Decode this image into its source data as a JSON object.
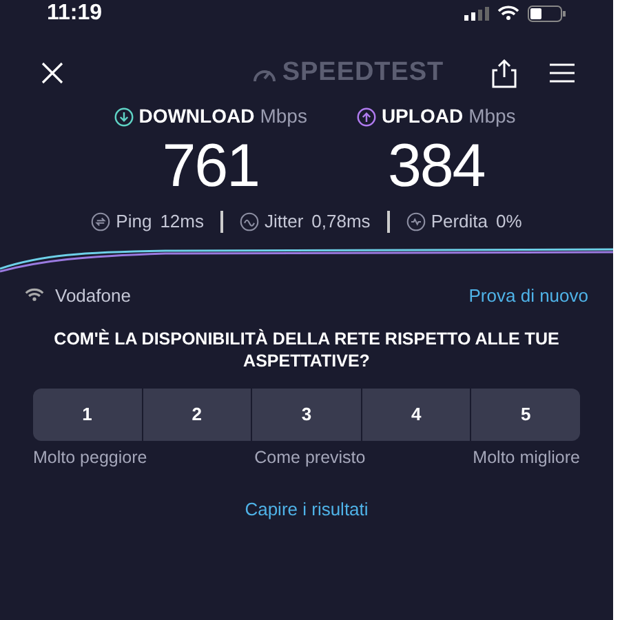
{
  "status_bar": {
    "time": "11:19"
  },
  "header": {
    "title": "SPEEDTEST"
  },
  "results": [
    {
      "kind": "download",
      "label": "DOWNLOAD",
      "unit": "Mbps",
      "value": "761"
    },
    {
      "kind": "upload",
      "label": "UPLOAD",
      "unit": "Mbps",
      "value": "384"
    }
  ],
  "stats": [
    {
      "kind": "ping",
      "label": "Ping",
      "value": "12ms"
    },
    {
      "kind": "jitter",
      "label": "Jitter",
      "value": "0,78ms"
    },
    {
      "kind": "loss",
      "label": "Perdita",
      "value": "0%"
    }
  ],
  "provider": {
    "name": "Vodafone",
    "retry": "Prova di nuovo"
  },
  "survey": {
    "question": "COM'È LA DISPONIBILITÀ DELLA RETE RISPETTO ALLE TUE ASPETTATIVE?",
    "options": [
      {
        "label": "1",
        "selected": false
      },
      {
        "label": "2",
        "selected": false
      },
      {
        "label": "3",
        "selected": false
      },
      {
        "label": "4",
        "selected": false
      },
      {
        "label": "5",
        "selected": false
      }
    ],
    "scale_labels": [
      "Molto peggiore",
      "Come previsto",
      "Molto migliore"
    ]
  },
  "link": "Capire i risultati"
}
